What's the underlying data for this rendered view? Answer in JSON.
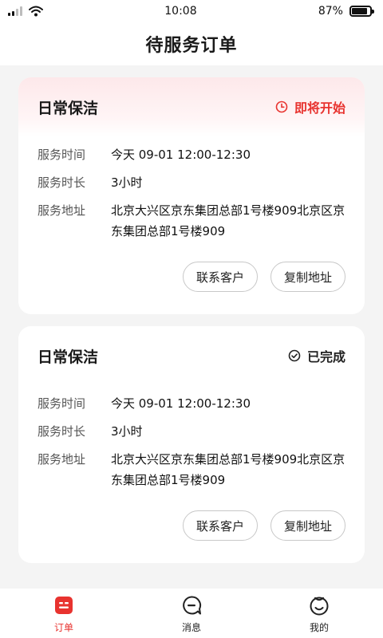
{
  "status_bar": {
    "time": "10:08",
    "battery": "87%",
    "battery_fraction": 0.87,
    "icons": [
      "signal-icon",
      "wifi-icon",
      "battery-icon"
    ]
  },
  "header": {
    "title": "待服务订单"
  },
  "orders": [
    {
      "title": "日常保洁",
      "status": "即将开始",
      "status_icon": "clock-icon",
      "status_color": "#e8332f",
      "rows": [
        {
          "label": "服务时间",
          "value": "今天 09-01 12:00-12:30"
        },
        {
          "label": "服务时长",
          "value": "3小时"
        },
        {
          "label": "服务地址",
          "value": "北京大兴区京东集团总部1号楼909北京区京东集团总部1号楼909"
        }
      ],
      "actions": {
        "contact": "联系客户",
        "copy": "复制地址"
      }
    },
    {
      "title": "日常保洁",
      "status": "已完成",
      "status_icon": "check-circle-icon",
      "status_color": "#222222",
      "rows": [
        {
          "label": "服务时间",
          "value": "今天 09-01 12:00-12:30"
        },
        {
          "label": "服务时长",
          "value": "3小时"
        },
        {
          "label": "服务地址",
          "value": "北京大兴区京东集团总部1号楼909北京区京东集团总部1号楼909"
        }
      ],
      "actions": {
        "contact": "联系客户",
        "copy": "复制地址"
      }
    }
  ],
  "tabbar": {
    "items": [
      {
        "label": "订单",
        "icon": "order-icon",
        "active": true
      },
      {
        "label": "消息",
        "icon": "message-icon",
        "active": false
      },
      {
        "label": "我的",
        "icon": "profile-icon",
        "active": false
      }
    ]
  },
  "colors": {
    "accent": "#e8332f",
    "background": "#f4f4f4"
  }
}
